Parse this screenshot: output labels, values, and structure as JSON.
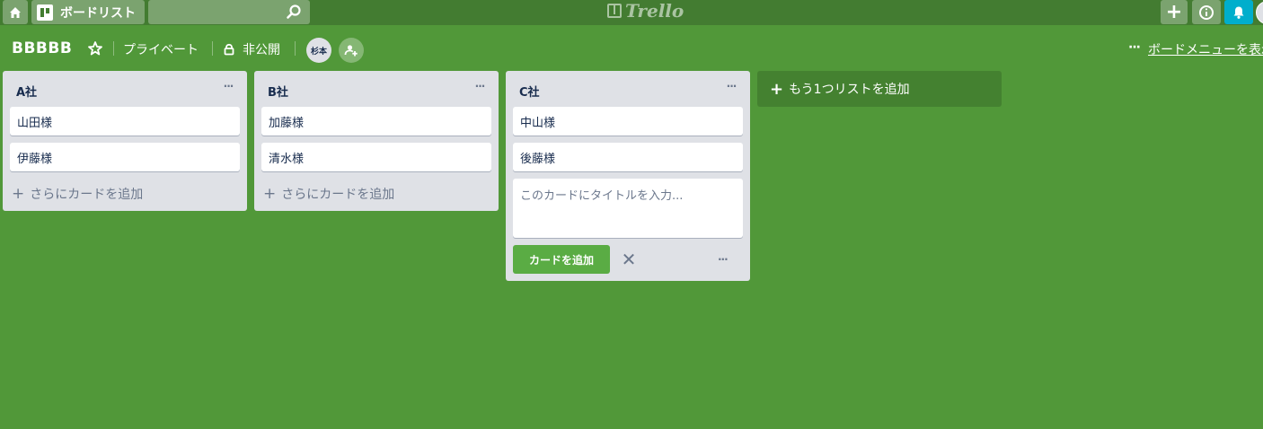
{
  "header": {
    "boards_label": "ボードリスト",
    "search_value": "",
    "logo_text": "Trello",
    "create_label": "+",
    "info_label": "i"
  },
  "board": {
    "title": "BBBBB",
    "team": "プライベート",
    "visibility": "非公開",
    "member_initials": "杉本",
    "menu_dots": "···",
    "menu_link": "ボードメニューを表示"
  },
  "lists": [
    {
      "title": "A社",
      "menu": "···",
      "cards": [
        "山田様",
        "伊藤様"
      ],
      "add_card_label": "さらにカードを追加"
    },
    {
      "title": "B社",
      "menu": "···",
      "cards": [
        "加藤様",
        "清水様"
      ],
      "add_card_label": "さらにカードを追加"
    },
    {
      "title": "C社",
      "menu": "···",
      "cards": [
        "中山様",
        "後藤様"
      ],
      "composer": {
        "placeholder": "このカードにタイトルを入力...",
        "value": "",
        "add_button": "カードを追加",
        "cancel": "✕",
        "more": "···"
      }
    }
  ],
  "add_list_label": "もう1つリストを追加",
  "colors": {
    "board_bg": "#519839",
    "header_bg": "#437c31",
    "list_bg": "#dfe1e6",
    "add_button": "#5aac44",
    "notification": "#00aecc"
  },
  "icons": [
    "home-icon",
    "boards-icon",
    "search-icon",
    "trello-logo-icon",
    "plus-icon",
    "info-icon",
    "bell-icon",
    "star-icon",
    "lock-icon",
    "add-member-icon",
    "more-icon",
    "close-icon"
  ]
}
